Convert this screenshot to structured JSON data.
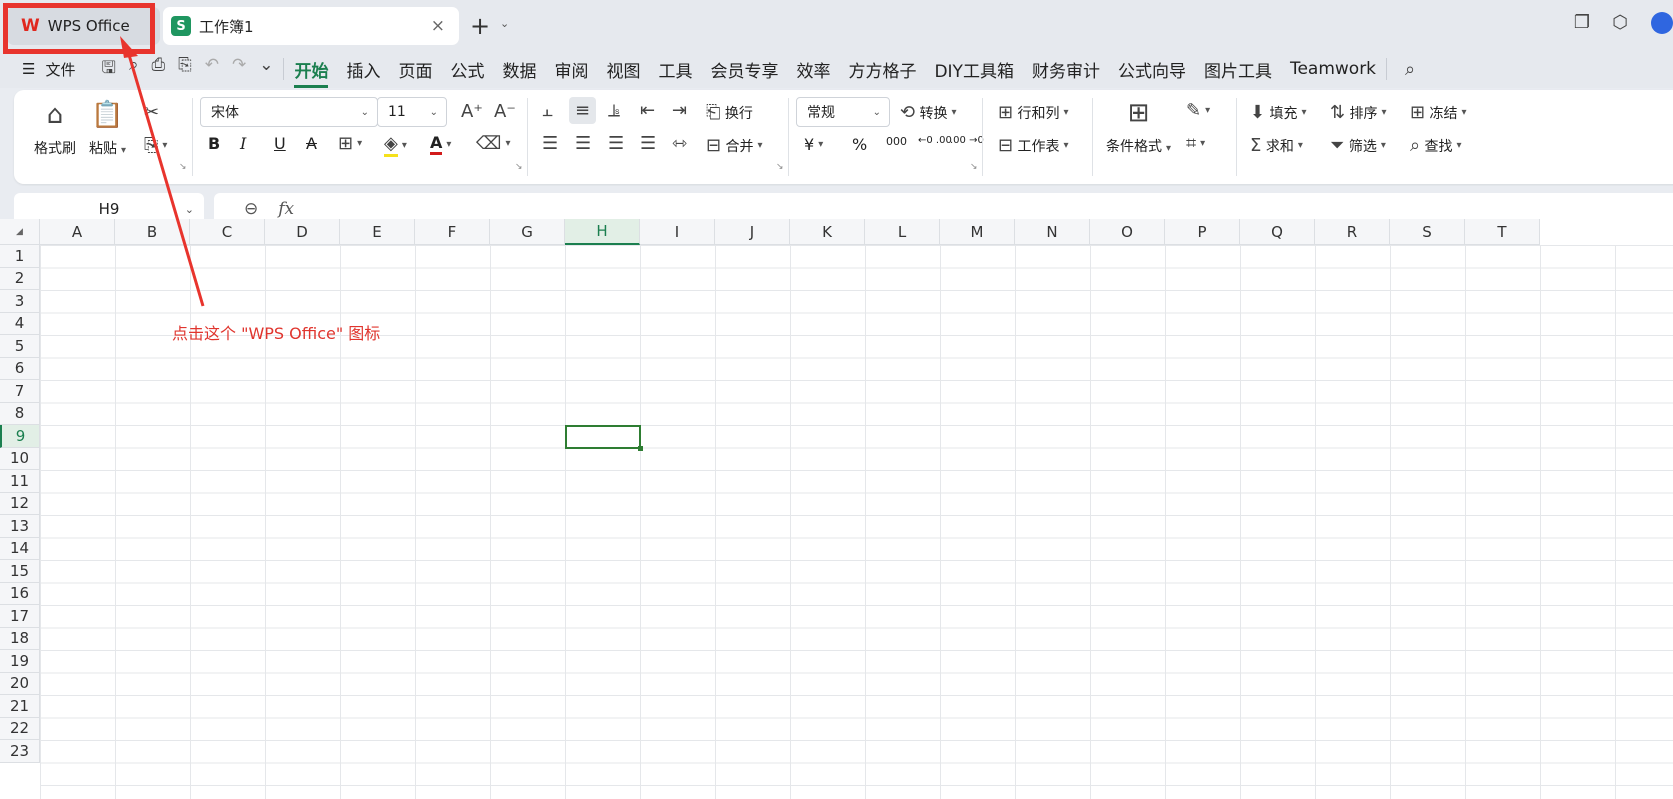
{
  "tabs": {
    "wps": {
      "logo": "W",
      "label": "WPS Office"
    },
    "workbook": {
      "logo": "S",
      "label": "工作簿1",
      "close": "×"
    },
    "new_tab": "+",
    "new_tab_dropdown": "⌄"
  },
  "window_icons": [
    "restore-icon",
    "cube-icon",
    "avatar"
  ],
  "menubar": {
    "file_icon": "☰",
    "file_label": "文件",
    "quick_access": [
      "save-icon",
      "format-painter-icon",
      "print-icon",
      "print-preview-icon",
      "undo-icon",
      "redo-icon",
      "more-icon"
    ],
    "menus": [
      "开始",
      "插入",
      "页面",
      "公式",
      "数据",
      "审阅",
      "视图",
      "工具",
      "会员专享",
      "效率",
      "方方格子",
      "DIY工具箱",
      "财务审计",
      "公式向导",
      "图片工具",
      "Teamwork"
    ],
    "active_menu": "开始"
  },
  "ribbon": {
    "format_painter": "格式刷",
    "paste": "粘贴",
    "font_name": "宋体",
    "font_size": "11",
    "wrap": "换行",
    "merge": "合并",
    "number_format": "常规",
    "convert": "转换",
    "rows_cols": "行和列",
    "worksheet": "工作表",
    "conditional_format": "条件格式",
    "fill": "填充",
    "sort": "排序",
    "freeze": "冻结",
    "sum": "求和",
    "filter": "筛选",
    "find": "查找",
    "bold": "B",
    "italic": "I",
    "underline": "U",
    "strike": "A",
    "font_color_letter": "A",
    "percent": "%",
    "thousands": "000",
    "currency": "¥",
    "increase_font": "A⁺",
    "decrease_font": "A⁻",
    "dec_inc": "←0 .00",
    "dec_dec": ".00 →0"
  },
  "formula_bar": {
    "cell_ref": "H9",
    "fx": "fx",
    "value": ""
  },
  "sheet": {
    "columns": [
      "A",
      "B",
      "C",
      "D",
      "E",
      "F",
      "G",
      "H",
      "I",
      "J",
      "K",
      "L",
      "M",
      "N",
      "O",
      "P",
      "Q",
      "R",
      "S",
      "T"
    ],
    "rows": [
      "1",
      "2",
      "3",
      "4",
      "5",
      "6",
      "7",
      "8",
      "9",
      "10",
      "11",
      "12",
      "13",
      "14",
      "15",
      "16",
      "17",
      "18",
      "19",
      "20",
      "21",
      "22",
      "23"
    ],
    "selected_column": "H",
    "selected_row": "9"
  },
  "annotation": {
    "text": "点击这个 \"WPS Office\" 图标",
    "color": "#e0352e"
  },
  "colors": {
    "accent": "#1b7f4f",
    "annotation": "#e8342d",
    "wps_red": "#e0281f",
    "sheet_green": "#1f9660"
  }
}
